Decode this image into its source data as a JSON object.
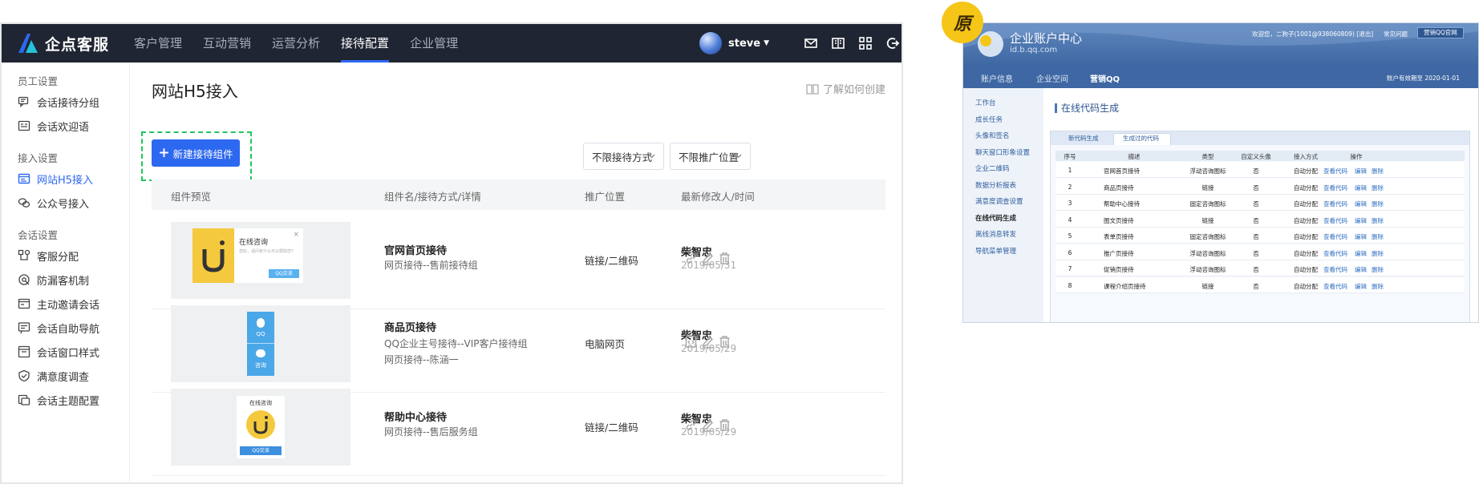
{
  "app": {
    "logo_text": "企点客服",
    "nav": [
      "客户管理",
      "互动营销",
      "运营分析",
      "接待配置",
      "企业管理"
    ],
    "nav_active": "接待配置",
    "username": "steve",
    "icons": [
      "mail-icon",
      "book-icon",
      "grid-icon",
      "logout-icon"
    ],
    "colors": {
      "topbar": "#1f2532",
      "accent": "#2d68f0",
      "highlight": "#22c45e"
    }
  },
  "sidebar": {
    "groups": [
      {
        "title": "员工设置",
        "items": [
          {
            "label": "会话接待分组",
            "icon": "chat-group-icon"
          },
          {
            "label": "会话欢迎语",
            "icon": "welcome-icon"
          }
        ]
      },
      {
        "title": "接入设置",
        "items": [
          {
            "label": "网站H5接入",
            "icon": "web-icon",
            "active": true
          },
          {
            "label": "公众号接入",
            "icon": "wechat-icon"
          }
        ]
      },
      {
        "title": "会话设置",
        "items": [
          {
            "label": "客服分配",
            "icon": "assign-icon"
          },
          {
            "label": "防漏客机制",
            "icon": "guard-icon"
          },
          {
            "label": "主动邀请会话",
            "icon": "invite-icon"
          },
          {
            "label": "会话自助导航",
            "icon": "nav-icon"
          },
          {
            "label": "会话窗口样式",
            "icon": "window-icon"
          },
          {
            "label": "满意度调查",
            "icon": "survey-icon"
          },
          {
            "label": "会话主题配置",
            "icon": "theme-icon"
          }
        ]
      }
    ]
  },
  "main": {
    "title": "网站H5接入",
    "learn": "了解如何创建",
    "new_button": "新建接待组件",
    "filter_method": "不限接待方式",
    "filter_position": "不限推广位置",
    "columns": [
      "组件预览",
      "组件名/接待方式/详情",
      "推广位置",
      "最新修改人/时间"
    ],
    "rows": [
      {
        "name": "官网首页接待",
        "details": [
          "网页接待--售前接待组"
        ],
        "position": "链接/二维码",
        "user": "柴智忠",
        "time": "2019/05/31",
        "preview": "popup",
        "preview_text": {
          "title": "在线咨询",
          "body": "您好，请问有什么可以帮助您?",
          "button": "QQ交谈"
        },
        "actions": [
          "link-icon",
          "edit-icon",
          "delete-icon"
        ]
      },
      {
        "name": "商品页接待",
        "details": [
          "QQ企业主号接待--VIP客户接待组",
          "网页接待--陈涵一"
        ],
        "position": "电脑网页",
        "user": "柴智忠",
        "time": "2019/05/29",
        "preview": "side-bar",
        "preview_text": {
          "qq": "QQ",
          "consult": "咨询"
        },
        "actions": [
          "code-icon",
          "edit-icon",
          "delete-icon"
        ]
      },
      {
        "name": "帮助中心接待",
        "details": [
          "网页接待--售后服务组"
        ],
        "position": "链接/二维码",
        "user": "柴智忠",
        "time": "2019/05/29",
        "preview": "card",
        "preview_text": {
          "title": "在线咨询",
          "button": "QQ交谈"
        },
        "actions": [
          "link-icon",
          "edit-icon",
          "delete-icon"
        ]
      }
    ]
  },
  "old_ui": {
    "badge": "原",
    "title": "企业账户中心",
    "domain": "id.b.qq.com",
    "welcome": "欢迎您，二狗子(1001@938060809)",
    "logout": "[退出]",
    "help": "常见问题",
    "official": "营销QQ官网",
    "tabs": [
      "账户信息",
      "企业空间",
      "营销QQ"
    ],
    "tab_active": "营销QQ",
    "expire": "账户有效期至   2020-01-01",
    "side_items": [
      "工作台",
      "成长任务",
      "头像和签名",
      "聊天窗口形象设置",
      "企业二维码",
      "数据分析报表",
      "满意度调查设置",
      "在线代码生成",
      "离线消息转发",
      "导航菜单管理"
    ],
    "side_active": "在线代码生成",
    "section_title": "在线代码生成",
    "subtabs": [
      "新代码生成",
      "生成过的代码"
    ],
    "subtab_active": "生成过的代码",
    "columns": [
      "序号",
      "描述",
      "类型",
      "自定义头像",
      "接入方式",
      "操作"
    ],
    "ops": [
      "查看代码",
      "编辑",
      "删除"
    ],
    "rows": [
      [
        "1",
        "官网首页接待",
        "浮动咨询图标",
        "否",
        "自动分配"
      ],
      [
        "2",
        "商品页接待",
        "链接",
        "否",
        "自动分配"
      ],
      [
        "3",
        "帮助中心接待",
        "固定咨询图标",
        "否",
        "自动分配"
      ],
      [
        "4",
        "图文页接待",
        "链接",
        "否",
        "自动分配"
      ],
      [
        "5",
        "表单页接待",
        "固定咨询图标",
        "否",
        "自动分配"
      ],
      [
        "6",
        "推广页接待",
        "浮动咨询图标",
        "否",
        "自动分配"
      ],
      [
        "7",
        "促销页接待",
        "浮动咨询图标",
        "否",
        "自动分配"
      ],
      [
        "8",
        "课程介绍页接待",
        "链接",
        "否",
        "自动分配"
      ]
    ]
  }
}
